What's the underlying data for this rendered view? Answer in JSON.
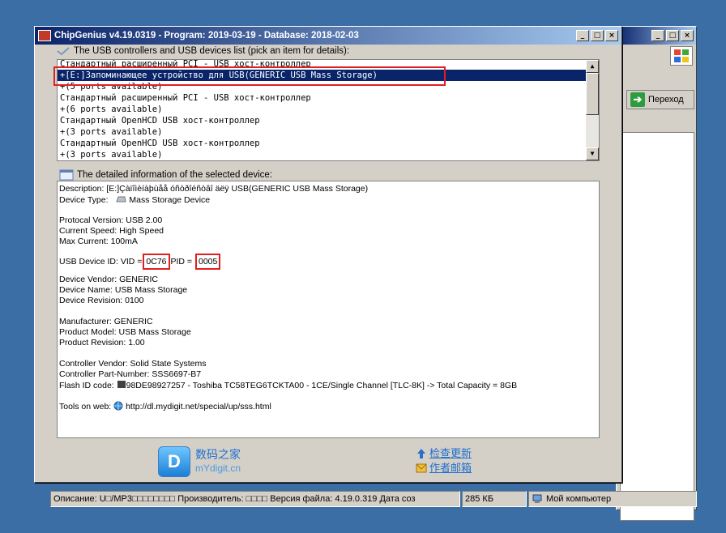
{
  "main_window": {
    "title": "ChipGenius v4.19.0319 - Program: 2019-03-19 - Database: 2018-02-03",
    "controls": {
      "minimize": "_",
      "maximize": "□",
      "close": "×"
    }
  },
  "background_window": {
    "controls": {
      "minimize": "_",
      "maximize": "□",
      "close": "×"
    },
    "go_button": "Переход"
  },
  "devices_list": {
    "label": "The USB controllers and USB devices list (pick an item for details):",
    "items": [
      "Стандартный расширенный PCI - USB хост-контроллер",
      "+[E:]Запоминающее устройство для USB(GENERIC USB Mass Storage)",
      "+(5 ports available)",
      "Стандартный расширенный PCI - USB хост-контроллер",
      "+(6 ports available)",
      "Стандартный OpenHCD USB хост-контроллер",
      "+(3 ports available)",
      "Стандартный OpenHCD USB хост-контроллер",
      "+(3 ports available)"
    ],
    "selected_index": 1
  },
  "details": {
    "label": "The detailed information of the selected device:",
    "description": "Description: [E:]Çàïîìèíàþùåå óñòðîéñòâî äëÿ USB(GENERIC USB Mass Storage)",
    "device_type_label": "Device Type:",
    "device_type_value": "Mass Storage Device",
    "protocol_version": "Protocal Version: USB 2.00",
    "current_speed": "Current Speed: High Speed",
    "max_current": "Max Current: 100mA",
    "usb_id_prefix": "USB Device ID: VID =",
    "vid": "0C76",
    "pid_label": "PID =",
    "pid": "0005",
    "device_vendor": "Device Vendor: GENERIC",
    "device_name": "Device Name: USB Mass Storage",
    "device_revision": "Device Revision: 0100",
    "manufacturer": "Manufacturer: GENERIC",
    "product_model": "Product Model: USB Mass Storage",
    "product_revision": "Product Revision: 1.00",
    "controller_vendor": "Controller Vendor: Solid State Systems",
    "controller_part": "Controller Part-Number: SSS6697-B7",
    "flash_id_label": "Flash ID code:",
    "flash_id_value": "98DE98927257 - Toshiba TC58TEG6TCKTA00 - 1CE/Single Channel [TLC-8K] -> Total Capacity = 8GB",
    "tools_label": "Tools on web:",
    "tools_url": "http://dl.mydigit.net/special/up/sss.html"
  },
  "footer": {
    "logo_cn": "数码之家",
    "logo_en": "mYdigit.cn",
    "check_update": "检查更新",
    "author_email": "作者邮箱"
  },
  "statusbar": {
    "description": "Описание: U□/MP3□□□□□□□□ Производитель: □□□□ Версия файла: 4.19.0.319 Дата соз",
    "size": "285 КБ",
    "location": "Мой компьютер"
  }
}
